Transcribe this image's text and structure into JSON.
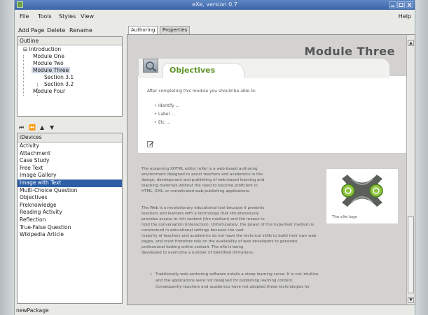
{
  "window": {
    "title": "eXe, version 0.7"
  },
  "menu": {
    "file": "File",
    "tools": "Tools",
    "styles": "Styles",
    "view": "View",
    "help": "Help"
  },
  "toolbar": {
    "add_page": "Add Page",
    "delete": "Delete",
    "rename": "Rename"
  },
  "outline": {
    "header": "Outline",
    "items": [
      {
        "label": "Introduction",
        "level": 0,
        "selected": false
      },
      {
        "label": "Module One",
        "level": 1,
        "selected": false
      },
      {
        "label": "Module Two",
        "level": 1,
        "selected": false
      },
      {
        "label": "Module Three",
        "level": 1,
        "selected": true
      },
      {
        "label": "Section 3.1",
        "level": 2,
        "selected": false
      },
      {
        "label": "Section 3.2",
        "level": 2,
        "selected": false
      },
      {
        "label": "Module Four",
        "level": 1,
        "selected": false
      }
    ]
  },
  "nav": {
    "first": "⏮",
    "prev": "⏪",
    "up": "▲",
    "down": "▼"
  },
  "idevices": {
    "header": "iDevices",
    "items": [
      {
        "label": "Activity",
        "selected": false
      },
      {
        "label": "Attachment",
        "selected": false
      },
      {
        "label": "Case Study",
        "selected": false
      },
      {
        "label": "Free Text",
        "selected": false
      },
      {
        "label": "Image Gallery",
        "selected": false
      },
      {
        "label": "Image with Text",
        "selected": true
      },
      {
        "label": "Multi-Choice Question",
        "selected": false
      },
      {
        "label": "Objectives",
        "selected": false
      },
      {
        "label": "Preknowledge",
        "selected": false
      },
      {
        "label": "Reading Activity",
        "selected": false
      },
      {
        "label": "Reflection",
        "selected": false
      },
      {
        "label": "True-False Question",
        "selected": false
      },
      {
        "label": "Wikipedia Article",
        "selected": false
      }
    ]
  },
  "status": "newPackage",
  "tabs": [
    {
      "label": "Authoring",
      "active": true
    },
    {
      "label": "Properties",
      "active": false
    }
  ],
  "page": {
    "module_title": "Module Three",
    "objectives": {
      "title": "Objectives",
      "intro": "After completing this module you should be able to:",
      "bullets": [
        "Identify ...",
        "Label ...",
        "Etc ..."
      ]
    },
    "paragraph1": [
      "The eLearning XHTML editor (eXe) is a web-based authoring",
      "environment designed to assist teachers and academics in the",
      "design, development and publishing of web-based learning and",
      "teaching materials without the need to become proficient in",
      "HTML, XML, or complicated web-publishing applications."
    ],
    "paragraph2": [
      "The Web is a revolutionary educational tool because it presents",
      "teachers and learners with a technology that simultaneously",
      "provides access to rich content (the medium) and the means to",
      "hold the conversation (interaction). Unfortunately, the power of this hypertext medium is",
      "constrained in educational settings because the vast",
      "majority of teachers and academics do not have the technical skills to build their own web",
      "pages, and must therefore rely on the availability of web developers to generate",
      "professional looking online content. The eXe is being",
      "developed to overcome a number of identified limitations:"
    ],
    "bullet2": [
      "Traditionally web-authoring software entails a steep learning curve. It is not intuitive",
      "and the applications were not designed for publishing learning content.",
      "Consequently teachers and academics have not adopted these technologies for"
    ],
    "logo_caption": "The eXe logo"
  },
  "colors": {
    "title_bar": "#3c64a8",
    "selection": "#2d5ea6",
    "objectives_green": "#5f9328"
  }
}
